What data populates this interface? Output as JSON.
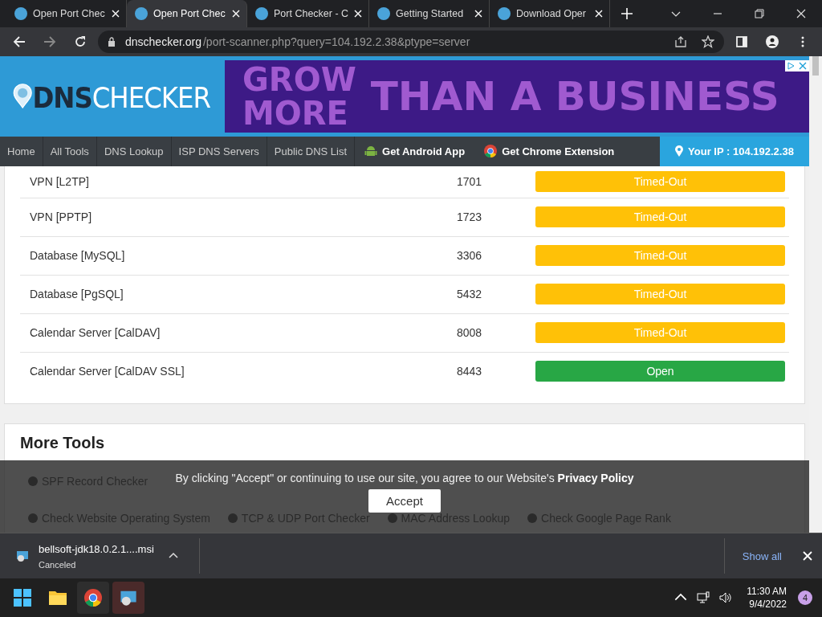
{
  "browser": {
    "tabs": [
      {
        "title": "Open Port Chec",
        "selected": false
      },
      {
        "title": "Open Port Chec",
        "selected": true
      },
      {
        "title": "Port Checker - C",
        "selected": false
      },
      {
        "title": "Getting Started",
        "selected": false
      },
      {
        "title": "Download Oper",
        "selected": false
      }
    ],
    "url_host": "dnschecker.org",
    "url_path": "/port-scanner.php?query=104.192.2.38&ptype=server"
  },
  "site": {
    "logo_left": "DNS",
    "logo_right": "CHECKER",
    "ad_line1": "GROW",
    "ad_line2": "MORE",
    "ad_rest": "THAN A BUSINESS",
    "nav": [
      {
        "label": "Home",
        "kind": "plain"
      },
      {
        "label": "All Tools",
        "kind": "plain"
      },
      {
        "label": "DNS Lookup",
        "kind": "plain"
      },
      {
        "label": "ISP DNS Servers",
        "kind": "plain"
      },
      {
        "label": "Public DNS List",
        "kind": "plain"
      },
      {
        "label": "Get Android App",
        "kind": "android"
      },
      {
        "label": "Get Chrome Extension",
        "kind": "chrome"
      }
    ],
    "your_ip": "Your IP : 104.192.2.38"
  },
  "ports": [
    {
      "service": "VPN [L2TP]",
      "port": "1701",
      "status": "Timed-Out",
      "color": "#ffc107"
    },
    {
      "service": "VPN [PPTP]",
      "port": "1723",
      "status": "Timed-Out",
      "color": "#ffc107"
    },
    {
      "service": "Database [MySQL]",
      "port": "3306",
      "status": "Timed-Out",
      "color": "#ffc107"
    },
    {
      "service": "Database [PgSQL]",
      "port": "5432",
      "status": "Timed-Out",
      "color": "#ffc107"
    },
    {
      "service": "Calendar Server [CalDAV]",
      "port": "8008",
      "status": "Timed-Out",
      "color": "#ffc107"
    },
    {
      "service": "Calendar Server [CalDAV SSL]",
      "port": "8443",
      "status": "Open",
      "color": "#28a745"
    }
  ],
  "more_tools": {
    "title": "More Tools",
    "items": [
      [
        "SPF Record Checker"
      ],
      [
        "Check Website Operating System",
        "TCP & UDP Port Checker",
        "MAC Address Lookup",
        "Check Google Page Rank"
      ]
    ]
  },
  "cookie": {
    "text": "By clicking \"Accept\" or continuing to use our site, you agree to our Website's ",
    "link": "Privacy Policy",
    "button": "Accept"
  },
  "download": {
    "file": "bellsoft-jdk18.0.2.1....msi",
    "status": "Canceled",
    "show_all": "Show all"
  },
  "taskbar": {
    "time": "11:30 AM",
    "date": "9/4/2022",
    "badge": "4"
  }
}
